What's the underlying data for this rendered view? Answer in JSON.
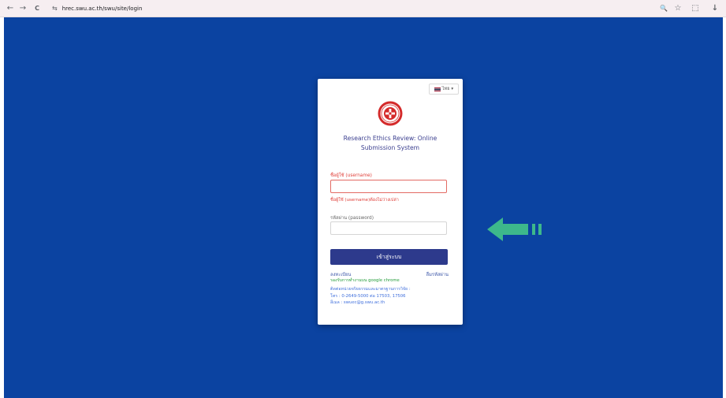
{
  "browser": {
    "back": "←",
    "forward": "→",
    "reload": "C",
    "site_icon": "⇆",
    "url": "hrec.swu.ac.th/swu/site/login",
    "zoom": "🔍",
    "star": "☆",
    "extensions": "⬚",
    "download": "↓"
  },
  "card": {
    "language": "ไทย",
    "language_caret": "▾",
    "title_line1": "Research Ethics Review: Online",
    "title_line2": "Submission System",
    "username_label": "ชื่อผู้ใช้ (username)",
    "username_value": "",
    "username_error": "ชื่อผู้ใช้ (username)ต้องไม่ว่างเปล่า",
    "password_label": "รหัสผ่าน (password)",
    "password_value": "",
    "login_button": "เข้าสู่ระบบ",
    "register_link": "ลงทะเบียน",
    "forgot_link": "ลืมรหัสผ่าน",
    "browser_note": "รองรับการทำงานบน google chrome",
    "contact_line1": "ติดต่อหน่วยจริยธรรมและมาตรฐานการวิจัย :",
    "contact_line2": "โทร : 0-2649-5000 ต่อ 17503, 17506",
    "contact_line3": "อีเมล : swuec@g.swu.ac.th"
  },
  "colors": {
    "page_background": "#0b43a1",
    "login_button": "#2d3a8c",
    "error": "#e0403a",
    "annotation_arrow": "#3db88b"
  }
}
